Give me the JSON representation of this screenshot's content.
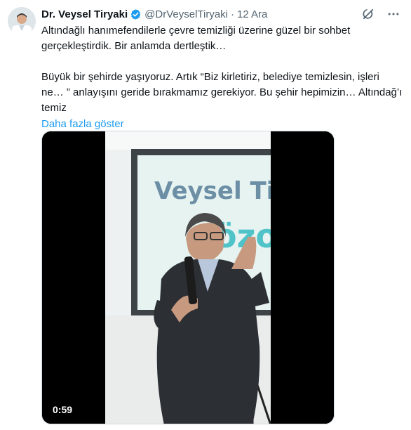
{
  "author": {
    "name": "Dr. Veysel Tiryaki",
    "handle": "@DrVeyselTiryaki",
    "separator": "·",
    "date": "12 Ara",
    "verified": true,
    "verified_color": "#1d9bf0"
  },
  "icons": {
    "verified": "verified-badge-icon",
    "grok": "grok-icon",
    "more": "more-dots-icon"
  },
  "tweet": {
    "paragraph1_line1": "Altındağlı hanımefendilerle çevre temizliği üzerine güzel bir sohbet",
    "paragraph1_line2": "gerçekleştirdik. Bir anlamda dertleştik…",
    "paragraph2_line1": "Büyük bir şehirde yaşıyoruz. Artık “Biz kirletiriz,  belediye temizlesin, işleri",
    "paragraph2_line2": "ne… ” anlayışını geride bırakmamız gerekiyor. Bu şehir hepimizin… Altındağ’ı",
    "paragraph2_line3": "temiz",
    "show_more": "Daha fazla göster"
  },
  "video": {
    "duration": "0:59",
    "slide_text_line1": "Veysel Tiry",
    "slide_text_line2": "özo"
  },
  "colors": {
    "link": "#1d9bf0",
    "secondary_text": "#536471",
    "slide_bg": "#e6f3f1",
    "slide_text": "#6d8fa6",
    "slide_accent": "#4fc3c8"
  }
}
